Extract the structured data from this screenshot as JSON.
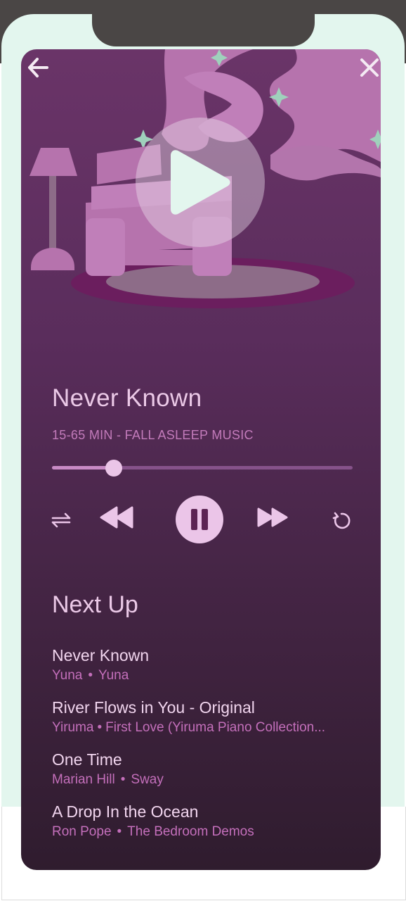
{
  "player": {
    "title": "Never Known",
    "subtitle": "15-65 MIN - FALL ASLEEP MUSIC",
    "progress": 0.205
  },
  "icons": {
    "back": "arrow-left-icon",
    "close": "close-icon",
    "hero_play": "play-icon",
    "repeat": "repeat-icon",
    "rewind": "rewind-icon",
    "pause": "pause-icon",
    "forward": "fast-forward-icon",
    "replay": "replay-icon"
  },
  "queue": {
    "heading": "Next Up",
    "items": [
      {
        "title": "Never Known",
        "artist": "Yuna",
        "album": "Yuna",
        "separator": "•"
      },
      {
        "title": "River Flows in You - Original",
        "artist": "Yiruma",
        "album": "First Love (Yiruma Piano Collection...",
        "separator": "•"
      },
      {
        "title": "One Time",
        "artist": "Marian Hill",
        "album": "Sway",
        "separator": "•"
      },
      {
        "title": "A Drop In the Ocean",
        "artist": "Ron Pope",
        "album": "The Bedroom Demos",
        "separator": "•"
      }
    ]
  },
  "colors": {
    "accent": "#ebc5e8",
    "subtitle": "#c37bbb",
    "mint": "#e3f6ee",
    "screen_top": "#6a3468",
    "screen_bottom": "#2f1c2e"
  }
}
